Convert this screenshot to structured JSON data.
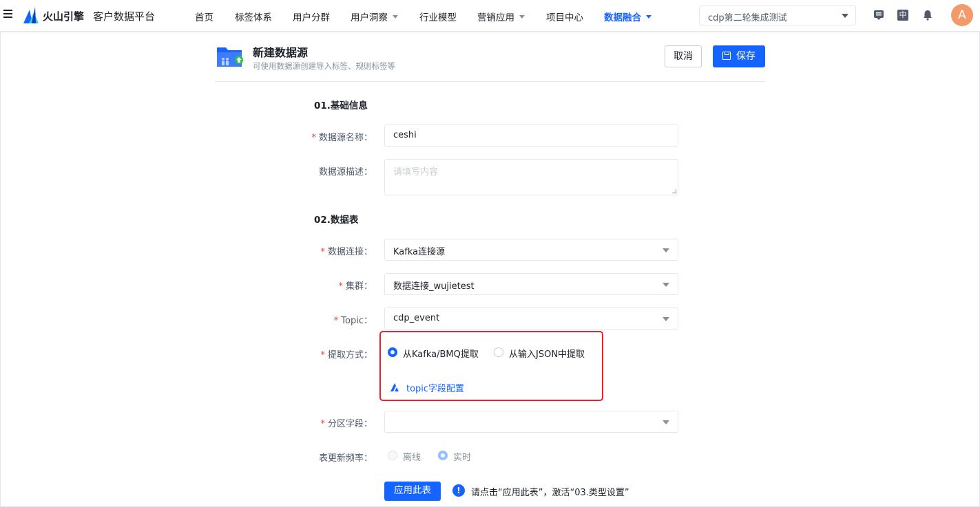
{
  "header": {
    "brand": "火山引擎",
    "product": "客户数据平台",
    "nav": [
      "首页",
      "标签体系",
      "用户分群",
      "用户洞察",
      "行业模型",
      "营销应用",
      "项目中心",
      "数据融合"
    ],
    "project_select": "cdp第二轮集成测试",
    "lang_button": "中",
    "avatar_letter": "A"
  },
  "page": {
    "title": "新建数据源",
    "subtitle": "可使用数据源创建导入标签、规则标签等",
    "cancel_label": "取消",
    "save_label": "保存"
  },
  "form": {
    "section1": "01.基础信息",
    "name_label": "数据源名称",
    "name_value": "ceshi",
    "desc_label": "数据源描述",
    "desc_placeholder": "请填写内容",
    "section2": "02.数据表",
    "conn_label": "数据连接",
    "conn_value": "Kafka连接源",
    "cluster_label": "集群",
    "cluster_value": "数据连接_wujietest",
    "topic_label": "Topic",
    "topic_value": "cdp_event",
    "extract_label": "提取方式",
    "extract_opt1": "从Kafka/BMQ提取",
    "extract_opt2": "从输入JSON中提取",
    "topic_link": "topic字段配置",
    "partition_label": "分区字段",
    "freq_label": "表更新频率",
    "freq_opt1": "离线",
    "freq_opt2": "实时",
    "apply_label": "应用此表",
    "apply_hint": "请点击“应用此表”，激活“03.类型设置”",
    "colon": "："
  },
  "colors": {
    "accent": "#1664ff",
    "required": "#f53f3f",
    "highlight": "#e8232f"
  }
}
